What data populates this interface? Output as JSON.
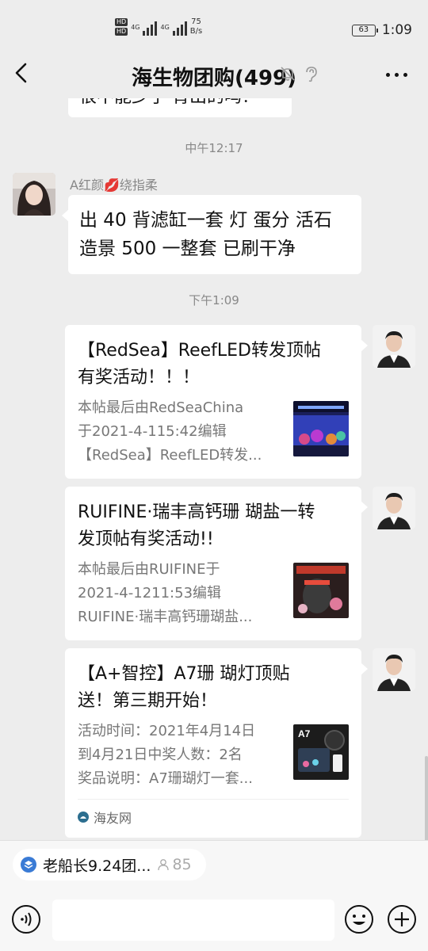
{
  "status_bar": {
    "hd1": "HD",
    "hd2": "HD",
    "sig1": "4G",
    "sig2": "4G",
    "net_speed_value": "75",
    "net_speed_unit": "B/s",
    "battery": "63",
    "time": "1:09"
  },
  "header": {
    "title": "海生物团购(499)"
  },
  "messages": {
    "top_partial_text": "很不能少了 背出的吗？",
    "time1": "中午12:17",
    "sender_name": "A红颜💋绕指柔",
    "msg1_line1": "出 40 背滤缸一套 灯 蛋分 活石",
    "msg1_line2": "造景 500 一整套 已刷干净",
    "time2": "下午1:09"
  },
  "cards": [
    {
      "title_line1": "【RedSea】ReefLED转发顶帖",
      "title_line2": "有奖活动！！！",
      "desc_line1": "本帖最后由RedSeaChina",
      "desc_line2": "于2021-4-115:42编辑",
      "desc_line3": "【RedSea】ReefLED转发..."
    },
    {
      "title_line1": "RUIFINE·瑞丰高钙珊 瑚盐一转",
      "title_line2": "发顶帖有奖活动!!",
      "desc_line1": "本帖最后由RUIFINE于",
      "desc_line2": "2021-4-1211:53编辑",
      "desc_line3": "RUIFINE·瑞丰高钙珊瑚盐..."
    },
    {
      "title_line1": "【A+智控】A7珊 瑚灯顶贴",
      "title_line2": "送！第三期开始！",
      "desc_line1": "活动时间：2021年4月14日",
      "desc_line2": "到4月21日中奖人数：2名",
      "desc_line3": "奖品说明：A7珊瑚灯一套...",
      "thumb_label": "A7",
      "source": "海友网"
    }
  ],
  "bottom": {
    "group_pill_label": "老船长9.24团...",
    "group_pill_count": "85"
  },
  "colors": {
    "background": "#ededed",
    "bubble": "#ffffff",
    "muted_text": "#888888"
  },
  "icons": [
    "back-arrow-icon",
    "mute-bell-icon",
    "ear-icon",
    "more-icon",
    "voice-icon",
    "emoji-icon",
    "plus-icon",
    "person-icon",
    "group-icon",
    "source-logo-icon"
  ]
}
